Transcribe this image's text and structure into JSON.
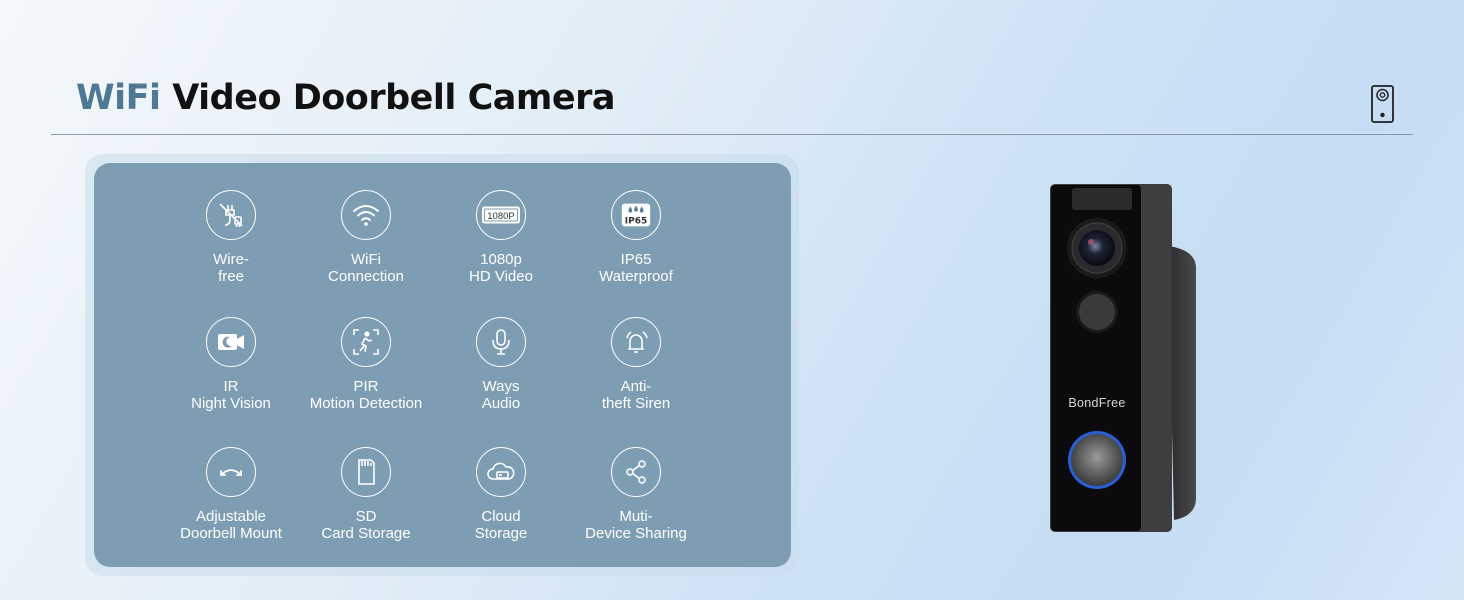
{
  "header": {
    "title_accent": "WiFi",
    "title_rest": " Video Doorbell Camera"
  },
  "features": [
    {
      "icon": "wire-free-icon",
      "lines": [
        "Wire-",
        "free"
      ]
    },
    {
      "icon": "wifi-icon",
      "lines": [
        "WiFi",
        "Connection"
      ]
    },
    {
      "icon": "1080p-icon",
      "icon_text": "1080P",
      "lines": [
        "1080p",
        "HD Video"
      ]
    },
    {
      "icon": "waterproof-icon",
      "icon_text": "IP65",
      "lines": [
        "IP65",
        "Waterproof"
      ]
    },
    {
      "icon": "night-vision-icon",
      "lines": [
        "IR",
        "Night Vision"
      ]
    },
    {
      "icon": "motion-detection-icon",
      "lines": [
        "PIR",
        "Motion Detection"
      ]
    },
    {
      "icon": "microphone-icon",
      "lines": [
        "Ways",
        "Audio"
      ]
    },
    {
      "icon": "siren-bell-icon",
      "lines": [
        "Anti-",
        "theft Siren"
      ]
    },
    {
      "icon": "rotate-arrows-icon",
      "lines": [
        "Adjustable",
        "Doorbell Mount"
      ]
    },
    {
      "icon": "sd-card-icon",
      "lines": [
        "SD",
        "Card Storage"
      ]
    },
    {
      "icon": "cloud-icon",
      "lines": [
        "Cloud",
        "Storage"
      ]
    },
    {
      "icon": "share-icon",
      "lines": [
        "Muti-",
        "Device Sharing"
      ]
    }
  ],
  "product": {
    "brand": "BondFree"
  },
  "colors": {
    "accent": "#4e7893",
    "panel": "#7d9db3"
  }
}
